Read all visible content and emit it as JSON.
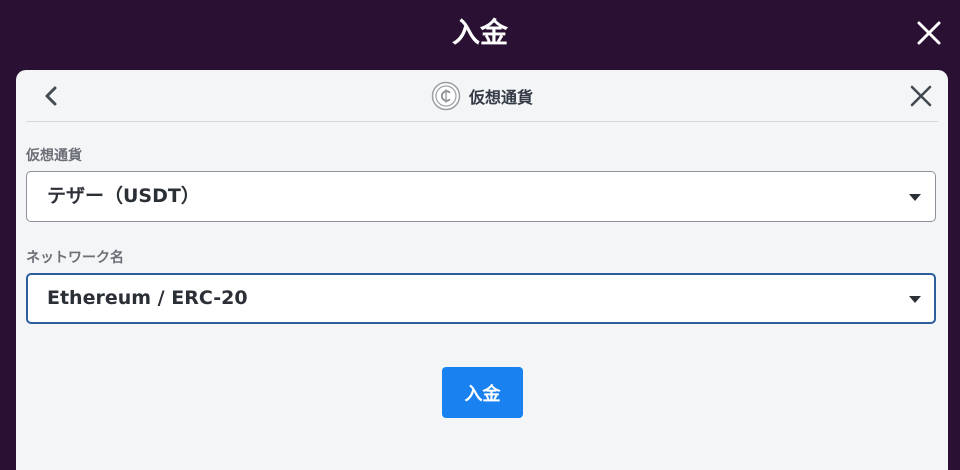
{
  "header": {
    "title": "入金"
  },
  "card": {
    "title": "仮想通貨",
    "currency": {
      "label": "仮想通貨",
      "value": "テザー（USDT）"
    },
    "network": {
      "label": "ネットワーク名",
      "value": "Ethereum / ERC-20"
    },
    "deposit_button": "入金"
  },
  "icons": [
    "close-icon",
    "back-chevron-icon",
    "coin-icon",
    "close-icon",
    "caret-down-icon"
  ],
  "colors": {
    "background": "#2a1133",
    "card": "#f4f5f7",
    "primary_button": "#1a82f0",
    "focus_border": "#2c5e9e"
  }
}
